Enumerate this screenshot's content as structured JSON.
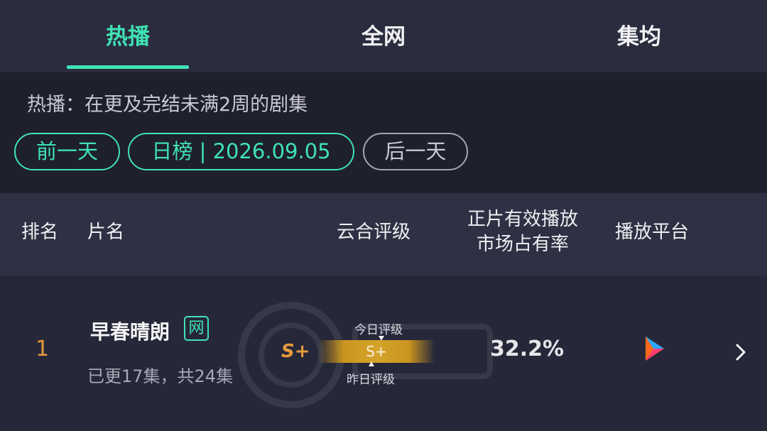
{
  "tabs": [
    {
      "label": "热播",
      "active": true
    },
    {
      "label": "全网",
      "active": false
    },
    {
      "label": "集均",
      "active": false
    }
  ],
  "filter": {
    "description": "热播：在更及完结未满2周的剧集",
    "prev_day": "前一天",
    "date_label": "日榜 | 2026.09.05",
    "next_day": "后一天"
  },
  "table_header": {
    "rank": "排名",
    "title": "片名",
    "rating": "云合评级",
    "share_line1": "正片有效播放",
    "share_line2": "市场占有率",
    "platform": "播放平台"
  },
  "rows": [
    {
      "rank": "1",
      "title": "早春晴朗",
      "badge": "网",
      "episodes": "已更17集，共24集",
      "grade": "S+",
      "today_label": "今日评级",
      "bar_grade": "S+",
      "yesterday_label": "昨日评级",
      "share": "32.2%",
      "platform_icon": "youku-play-icon"
    }
  ],
  "colors": {
    "accent": "#3fe3b4",
    "rank": "#e89a3c",
    "grade_bar": "#c9951f",
    "background": "#262839"
  }
}
